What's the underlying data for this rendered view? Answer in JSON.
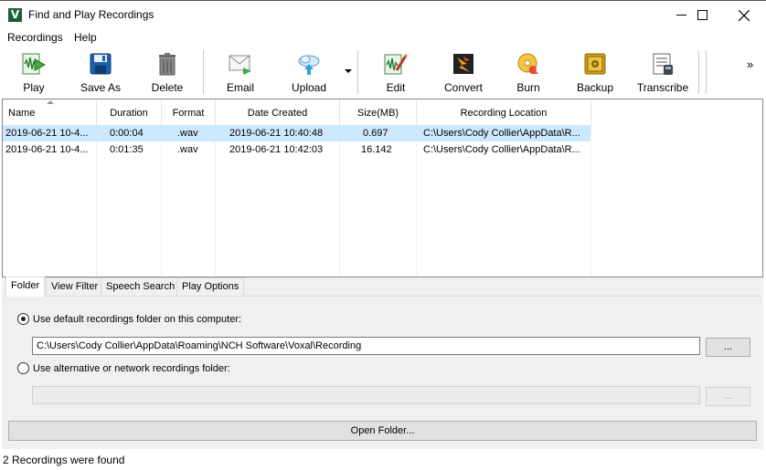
{
  "window": {
    "title": "Find and Play Recordings",
    "app_icon_letter": "V"
  },
  "menu": [
    "Recordings",
    "Help"
  ],
  "toolbar": {
    "buttons": [
      {
        "label": "Play",
        "icon": "play-icon"
      },
      {
        "label": "Save As",
        "icon": "save-icon"
      },
      {
        "label": "Delete",
        "icon": "trash-icon"
      },
      {
        "label": "Email",
        "icon": "email-icon"
      },
      {
        "label": "Upload",
        "icon": "upload-cloud-icon"
      },
      {
        "label": "Edit",
        "icon": "edit-waveform-icon"
      },
      {
        "label": "Convert",
        "icon": "convert-icon"
      },
      {
        "label": "Burn",
        "icon": "burn-disc-icon"
      },
      {
        "label": "Backup",
        "icon": "backup-safe-icon"
      },
      {
        "label": "Transcribe",
        "icon": "transcribe-icon"
      }
    ],
    "overflow_glyph": "»"
  },
  "recordings": {
    "columns": [
      "Name",
      "Duration",
      "Format",
      "Date Created",
      "Size(MB)",
      "Recording Location"
    ],
    "rows": [
      [
        "2019-06-21 10-4...",
        "0:00:04",
        ".wav",
        "2019-06-21 10:40:48",
        "0.697",
        "C:\\Users\\Cody Collier\\AppData\\R..."
      ],
      [
        "2019-06-21 10-4...",
        "0:01:35",
        ".wav",
        "2019-06-21 10:42:03",
        "16.142",
        "C:\\Users\\Cody Collier\\AppData\\R..."
      ]
    ],
    "selected_row": 0
  },
  "tabs": [
    "Folder",
    "View Filter",
    "Speech Search",
    "Play Options"
  ],
  "folder": {
    "default_label": "Use default recordings folder on this computer:",
    "default_path": "C:\\Users\\Cody Collier\\AppData\\Roaming\\NCH Software\\Voxal\\Recording",
    "browse_label": "...",
    "alt_label": "Use alternative or network recordings folder:",
    "alt_path": "",
    "alt_browse_label": "...",
    "open_folder_label": "Open Folder..."
  },
  "status": "2 Recordings were found",
  "colors": {
    "selection": "#cce8ff",
    "panel": "#f0f0f0"
  }
}
